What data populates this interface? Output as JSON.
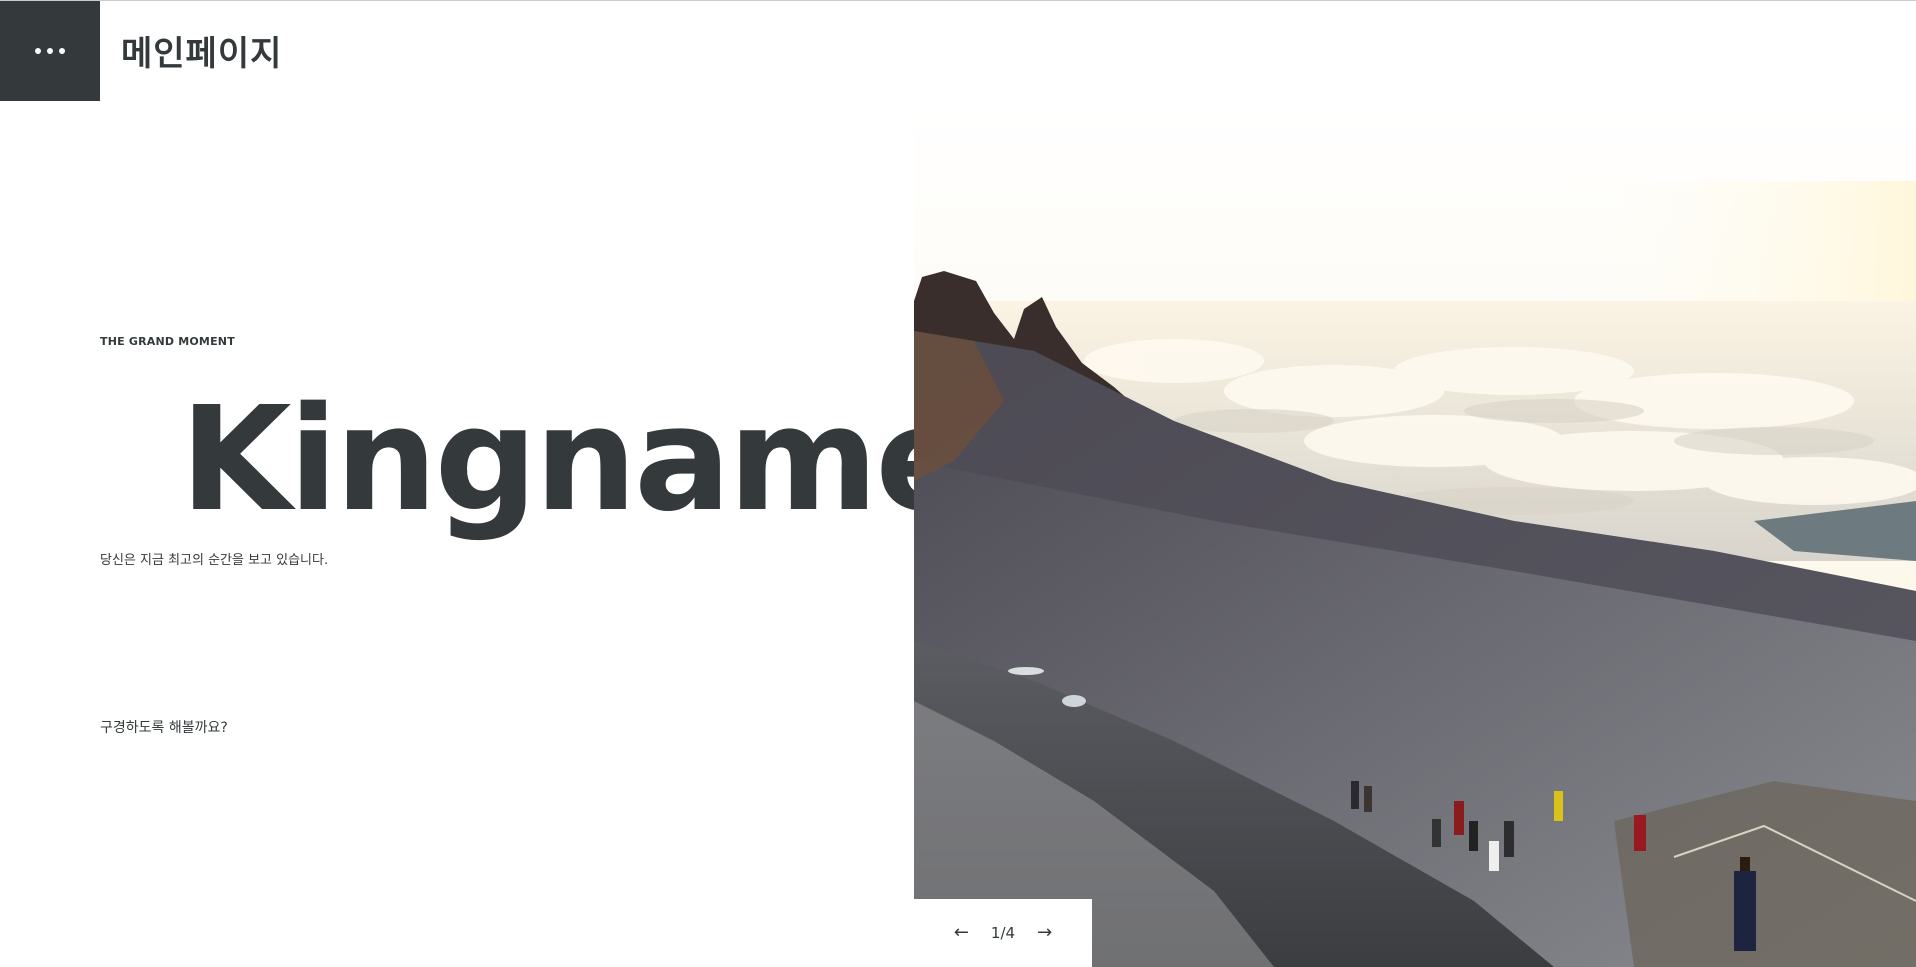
{
  "header": {
    "menu_icon": "ellipsis-icon",
    "title": "메인페이지"
  },
  "hero": {
    "eyebrow": "THE GRAND MOMENT",
    "title": "Kingname",
    "subtitle": "당신은 지금 최고의 순간을 보고 있습니다.",
    "cta": "구경하도록 해볼까요?"
  },
  "slider": {
    "prev_icon": "←",
    "next_icon": "→",
    "current": 1,
    "total": 4,
    "counter_text": "1/4"
  },
  "colors": {
    "primary_dark": "#343a3c",
    "background": "#ffffff"
  }
}
